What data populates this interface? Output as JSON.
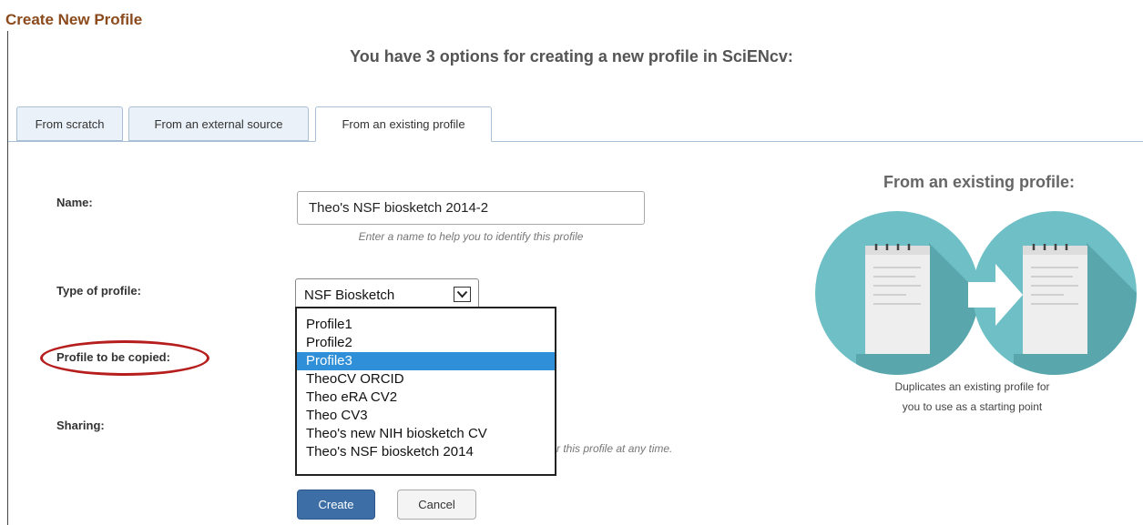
{
  "page": {
    "title": "Create New Profile",
    "subtitle": "You have 3 options for creating a new profile in SciENcv:"
  },
  "tabs": [
    {
      "label": "From scratch",
      "active": false
    },
    {
      "label": "From an external source",
      "active": false
    },
    {
      "label": "From an existing profile",
      "active": true
    }
  ],
  "form": {
    "name_label": "Name:",
    "name_value": "Theo's NSF biosketch 2014-2",
    "name_hint": "Enter a name to help you to identify this profile",
    "type_label": "Type of profile:",
    "type_value": "NSF Biosketch",
    "copy_label": "Profile to be copied:",
    "sharing_label": "Sharing:",
    "sharing_hint": "r this profile at any time.",
    "create_label": "Create",
    "cancel_label": "Cancel"
  },
  "dropdown": {
    "options": [
      "Profile1",
      "Profile2",
      "Profile3",
      "TheoCV ORCID",
      "Theo eRA CV2",
      "Theo CV3",
      "Theo's new NIH biosketch CV",
      "Theo's NSF biosketch 2014"
    ],
    "selected": "Profile3"
  },
  "info_panel": {
    "title": "From an existing profile:",
    "description_line1": "Duplicates an existing profile for",
    "description_line2": "you to use as a starting point"
  },
  "colors": {
    "title": "#8b4a1c",
    "accent": "#3d6fa6",
    "selection": "#2f8fd8",
    "highlight_oval": "#b61e1e",
    "illustration_teal": "#6fc0c6"
  },
  "icons": [
    "notepad-icon",
    "arrow-right-icon",
    "chevron-down-icon"
  ]
}
